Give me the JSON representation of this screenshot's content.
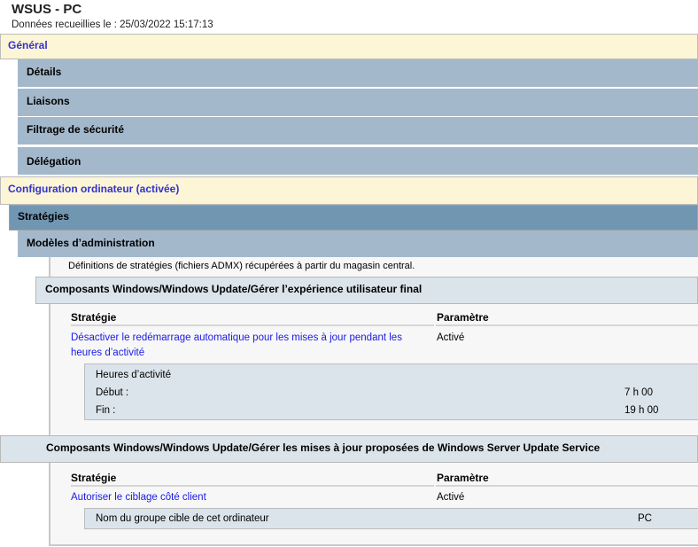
{
  "header": {
    "title": "WSUS - PC",
    "collected": "Données recueillies le : 25/03/2022 15:17:13"
  },
  "sections": {
    "general": "Général",
    "details": "Détails",
    "liaisons": "Liaisons",
    "filtrage": "Filtrage de sécurité",
    "delegation": "Délégation",
    "computer_config": "Configuration ordinateur (activée)",
    "strategies": "Stratégies",
    "admin_templates": "Modèles d’administration"
  },
  "admx_note": "Définitions de stratégies (fichiers ADMX) récupérées à partir du magasin central.",
  "groups": [
    {
      "title": "Composants Windows/Windows Update/Gérer l’expérience utilisateur final",
      "col_policy": "Stratégie",
      "col_setting": "Paramètre",
      "policy": "Désactiver le redémarrage automatique pour les mises à jour pendant les heures d’activité",
      "setting": "Activé",
      "details": {
        "heading": "Heures d’activité",
        "rows": [
          {
            "label": "Début :",
            "value": "7 h 00"
          },
          {
            "label": "Fin :",
            "value": "19 h 00"
          }
        ]
      }
    },
    {
      "title": "Composants Windows/Windows Update/Gérer les mises à jour proposées de Windows Server Update Service",
      "col_policy": "Stratégie",
      "col_setting": "Paramètre",
      "policy": "Autoriser le ciblage côté client",
      "setting": "Activé",
      "details": {
        "rows": [
          {
            "label": "Nom du groupe cible de cet ordinateur",
            "value": "PC"
          }
        ]
      }
    }
  ]
}
